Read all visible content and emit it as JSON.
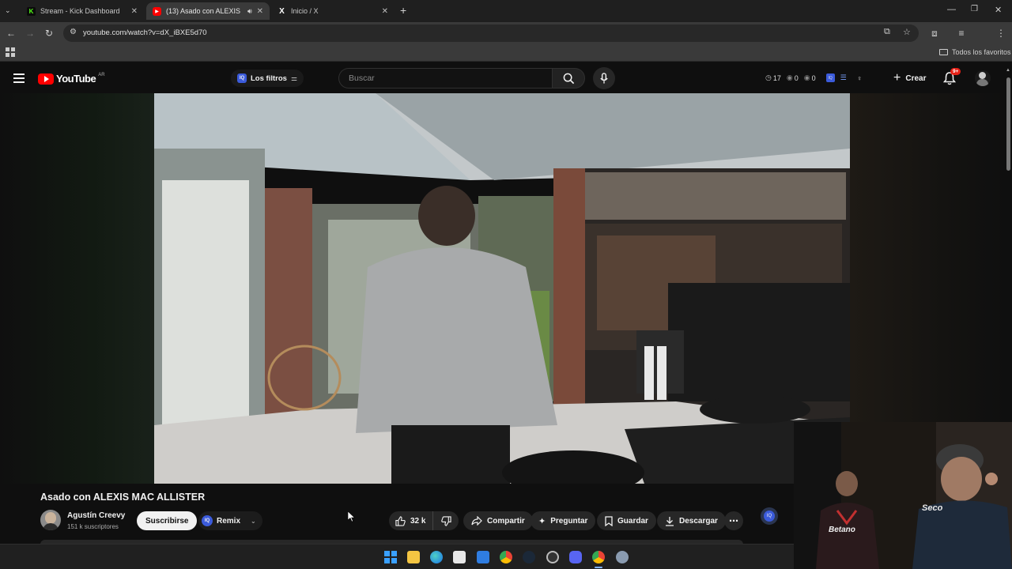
{
  "browser": {
    "tabs": [
      {
        "title": "Stream - Kick Dashboard",
        "active": false
      },
      {
        "title": "(13) Asado con ALEXIS MAC",
        "active": true
      },
      {
        "title": "Inicio / X",
        "active": false
      }
    ],
    "url": "youtube.com/watch?v=dX_iBXE5d70",
    "bookmarks_all": "Todos los favoritos"
  },
  "youtube": {
    "logo_text": "YouTube",
    "region": "AR",
    "filters_label": "Los filtros",
    "search_placeholder": "Buscar",
    "ext_stats": {
      "views": "17",
      "a": "0",
      "b": "0"
    },
    "create_label": "Crear",
    "notification_count": "9+"
  },
  "video": {
    "title": "Asado con ALEXIS MAC ALLISTER",
    "channel_name": "Agustín Creevy",
    "subscribers": "151 k suscriptores",
    "subscribe_label": "Suscribirse",
    "remix_label": "Remix",
    "likes": "32 k",
    "share_label": "Compartir",
    "ask_label": "Preguntar",
    "save_label": "Guardar",
    "download_label": "Descargar"
  },
  "webcam": {
    "shirt_text_left": "Betano",
    "shirt_text_right": "Seco"
  },
  "colors": {
    "yt_red": "#ff0000",
    "accent_blue": "#3ea6ff",
    "kick_green": "#53fc18"
  }
}
